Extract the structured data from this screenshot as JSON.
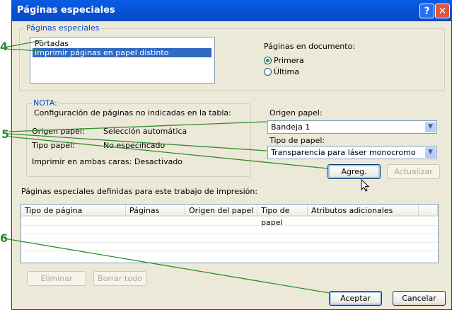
{
  "window": {
    "title": "Páginas especiales"
  },
  "titlebar_buttons": {
    "help": "?",
    "close": "✕"
  },
  "special_pages_group": {
    "legend": "Páginas especiales",
    "list_items": [
      "Portadas",
      "Imprimir páginas en papel distinto"
    ],
    "selected_index": 1,
    "doc_pages_label": "Páginas en documento:",
    "radio_options": [
      {
        "label": "Primera",
        "checked": true
      },
      {
        "label": "Última",
        "checked": false
      }
    ]
  },
  "note_group": {
    "legend": "NOTA:",
    "description": "Configuración de páginas no indicadas en la tabla:",
    "rows": [
      {
        "label": "Origen papel:",
        "value": "Selección automática"
      },
      {
        "label": "Tipo papel:",
        "value": "No especificado"
      }
    ],
    "duplex": "Imprimir en ambas caras:  Desactivado"
  },
  "paper_source": {
    "label": "Origen papel:",
    "value": "Bandeja 1"
  },
  "paper_type": {
    "label": "Tipo de papel:",
    "value": "Transparencia para láser monocromo"
  },
  "buttons": {
    "add": "Agreg.",
    "update": "Actualizar",
    "delete": "Eliminar",
    "clear_all": "Borrar todo",
    "accept": "Aceptar",
    "cancel": "Cancelar"
  },
  "table": {
    "caption": "Páginas especiales definidas para este trabajo de impresión:",
    "columns": [
      "Tipo de página",
      "Páginas",
      "Origen del papel",
      "Tipo de papel",
      "Atributos adicionales"
    ],
    "rows": []
  },
  "callouts": [
    "4",
    "5",
    "6"
  ],
  "colors": {
    "callout_green": "#2f8d2f",
    "selection_blue": "#316ac5",
    "title_blue": "#0a5ce5"
  },
  "icons": [
    "mouse-cursor-icon",
    "dropdown-arrow-icon"
  ]
}
